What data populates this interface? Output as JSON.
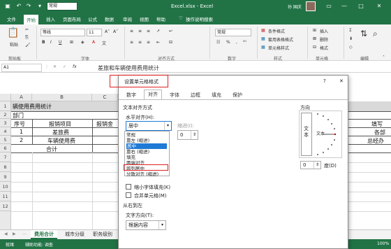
{
  "titlebar": {
    "title": "Excel.xlsx - Excel",
    "font_select": "常规",
    "user": "孙 国庆",
    "buttons": [
      "—",
      "□",
      "✕"
    ]
  },
  "tabs": [
    "文件",
    "开始",
    "插入",
    "页面布局",
    "公式",
    "数据",
    "审阅",
    "视图",
    "帮助",
    "操作说明搜索"
  ],
  "ribbon": {
    "paste": "粘贴",
    "clipboard": "剪贴板",
    "font_name": "等线",
    "font_size": "11",
    "font_group": "字体",
    "align_group": "对齐方式",
    "number_format": "常规",
    "number_group": "数字",
    "styles": [
      "条件格式",
      "套用表格格式",
      "单元格样式"
    ],
    "styles_group": "样式",
    "cells": [
      "插入",
      "删除",
      "格式"
    ],
    "cells_group": "单元格",
    "editing_group": "编辑"
  },
  "formula_bar": {
    "name_box": "A1",
    "fx": "fx",
    "content": "差旅和车辆使用费用统计"
  },
  "sheet": {
    "cols": [
      "A",
      "B",
      "C"
    ],
    "rows": [
      "1",
      "2",
      "3",
      "4",
      "5",
      "6",
      "7",
      "8",
      "9",
      "10",
      "11",
      "12"
    ],
    "r1": "辆使用费用统计",
    "r2": "部门",
    "r3": [
      "序号",
      "报销项目",
      "报销金"
    ],
    "r4": [
      "1",
      "差旅费"
    ],
    "r5": [
      "2",
      "车辆使用费"
    ],
    "r6": "合计",
    "right": [
      "填写",
      "各部",
      "总经办"
    ]
  },
  "sheet_tabs": [
    "费用合计",
    "城市分级",
    "职务级别"
  ],
  "status": {
    "text": "就绪",
    "access": "辅助功能: 调查",
    "zoom": "100%"
  },
  "dialog": {
    "title": "设置单元格格式",
    "help": "?",
    "close": "✕",
    "tabs": [
      "数字",
      "对齐",
      "字体",
      "边框",
      "填充",
      "保护"
    ],
    "section_text_align": "文本对齐方式",
    "horizontal_label": "水平对齐(H):",
    "horizontal_value": "居中",
    "indent_label": "缩进(I):",
    "indent_value": "0",
    "list": [
      "常规",
      "靠左 (缩进)",
      "居中",
      "靠右 (缩进)",
      "填充",
      "两端对齐",
      "跨列居中",
      "分散对齐 (缩进)"
    ],
    "checkboxes": [
      "缩小字体填充(K)",
      "合并单元格(M)"
    ],
    "rtl_section": "从右到左",
    "text_dir_label": "文字方向(T):",
    "text_dir_value": "根据内容",
    "orientation_label": "方向",
    "orientation_text": "文本",
    "degrees_value": "0",
    "degrees_label": "度(D)"
  }
}
